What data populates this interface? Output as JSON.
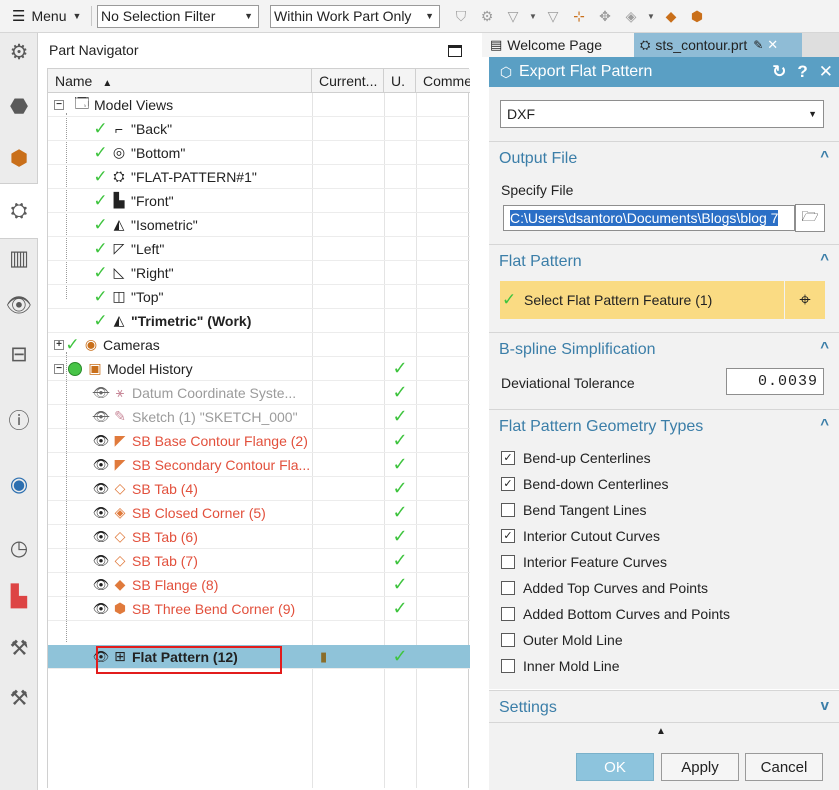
{
  "toolbar": {
    "menu_label": "Menu",
    "selection_filter": "No Selection Filter",
    "scope_filter": "Within Work Part Only"
  },
  "navigator": {
    "title": "Part Navigator",
    "columns": {
      "name": "Name",
      "current": "Current...",
      "u": "U.",
      "comment": "Comme"
    },
    "model_views_label": "Model Views",
    "views": [
      "\"Back\"",
      "\"Bottom\"",
      "\"FLAT-PATTERN#1\"",
      "\"Front\"",
      "\"Isometric\"",
      "\"Left\"",
      "\"Right\"",
      "\"Top\""
    ],
    "work_view": "\"Trimetric\" (Work)",
    "cameras_label": "Cameras",
    "history_label": "Model History",
    "history": [
      {
        "label": "Datum Coordinate Syste...",
        "style": "grey",
        "icon": "datum-csys-icon"
      },
      {
        "label": "Sketch (1) \"SKETCH_000\"",
        "style": "grey",
        "icon": "sketch-icon"
      },
      {
        "label": "SB Base Contour Flange (2)",
        "style": "red",
        "icon": "contour-flange-icon"
      },
      {
        "label": "SB Secondary Contour Fla...",
        "style": "red",
        "icon": "contour-flange-icon"
      },
      {
        "label": "SB Tab (4)",
        "style": "red",
        "icon": "tab-icon"
      },
      {
        "label": "SB Closed Corner (5)",
        "style": "red",
        "icon": "closed-corner-icon"
      },
      {
        "label": "SB Tab (6)",
        "style": "red",
        "icon": "tab-icon"
      },
      {
        "label": "SB Tab (7)",
        "style": "red",
        "icon": "tab-icon"
      },
      {
        "label": "SB Flange (8)",
        "style": "red",
        "icon": "flange-icon"
      },
      {
        "label": "SB Three Bend Corner (9)",
        "style": "red",
        "icon": "three-bend-corner-icon"
      }
    ],
    "selected_feature": "Flat Pattern (12)"
  },
  "tabs": {
    "welcome": "Welcome Page",
    "part": "sts_contour.prt"
  },
  "dialog": {
    "title": "Export Flat Pattern",
    "format": "DXF",
    "output_file": {
      "heading": "Output File",
      "specify_label": "Specify File",
      "path": "C:\\Users\\dsantoro\\Documents\\Blogs\\blog 7"
    },
    "flat_pattern": {
      "heading": "Flat Pattern",
      "select_label": "Select Flat Pattern Feature (1)"
    },
    "bspline": {
      "heading": "B-spline Simplification",
      "tolerance_label": "Deviational Tolerance",
      "tolerance_value": "0.0039"
    },
    "geometry": {
      "heading": "Flat Pattern Geometry Types",
      "options": [
        {
          "label": "Bend-up Centerlines",
          "checked": true
        },
        {
          "label": "Bend-down Centerlines",
          "checked": true
        },
        {
          "label": "Bend Tangent Lines",
          "checked": false
        },
        {
          "label": "Interior Cutout Curves",
          "checked": true
        },
        {
          "label": "Interior Feature Curves",
          "checked": false
        },
        {
          "label": "Added Top Curves and Points",
          "checked": false
        },
        {
          "label": "Added Bottom Curves and Points",
          "checked": false
        },
        {
          "label": "Outer Mold Line",
          "checked": false
        },
        {
          "label": "Inner Mold Line",
          "checked": false
        }
      ]
    },
    "settings_heading": "Settings",
    "buttons": {
      "ok": "OK",
      "apply": "Apply",
      "cancel": "Cancel"
    }
  },
  "colors": {
    "title_bar": "#5a9fc4",
    "selected_row": "#8fc3d9",
    "feature_red": "#e2503c",
    "check_green": "#3ec43e",
    "select_highlight": "#fadb83",
    "highlight_box": "#e21c1c"
  }
}
